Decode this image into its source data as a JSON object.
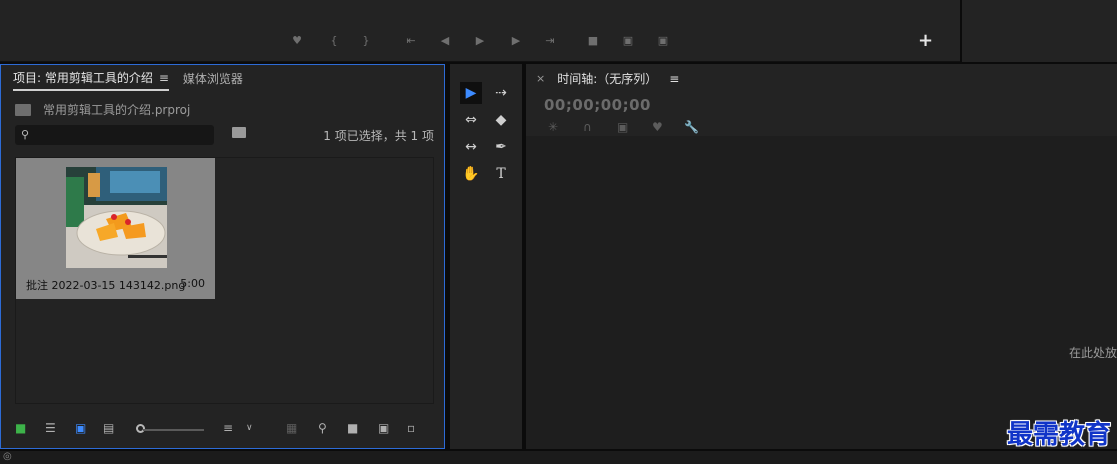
{
  "program_monitor": {
    "transport_icons": [
      "marker-icon",
      "in-point-icon",
      "out-point-icon",
      "go-to-in-icon",
      "step-back-icon",
      "play-icon",
      "step-forward-icon",
      "go-to-out-icon",
      "lift-icon",
      "extract-icon",
      "export-frame-icon"
    ],
    "add_button": "+"
  },
  "project_panel": {
    "tab_project": "项目: 常用剪辑工具的介绍",
    "tab_media_browser": "媒体浏览器",
    "project_file": "常用剪辑工具的介绍.prproj",
    "search_placeholder": "",
    "selection_count": "1 项已选择，共 1 项",
    "clip": {
      "name": "批注 2022-03-15 143142.png",
      "duration": "5:00"
    },
    "zoom_level": 0.05
  },
  "timeline_panel": {
    "title": "时间轴:（无序列）",
    "timecode": "00;00;00;00",
    "drop_hint": "在此处放"
  },
  "watermark": "最需教育",
  "colors": {
    "accent_blue": "#2d6bd6",
    "tool_active": "#3d8bff",
    "watermark": "#1034c8"
  }
}
